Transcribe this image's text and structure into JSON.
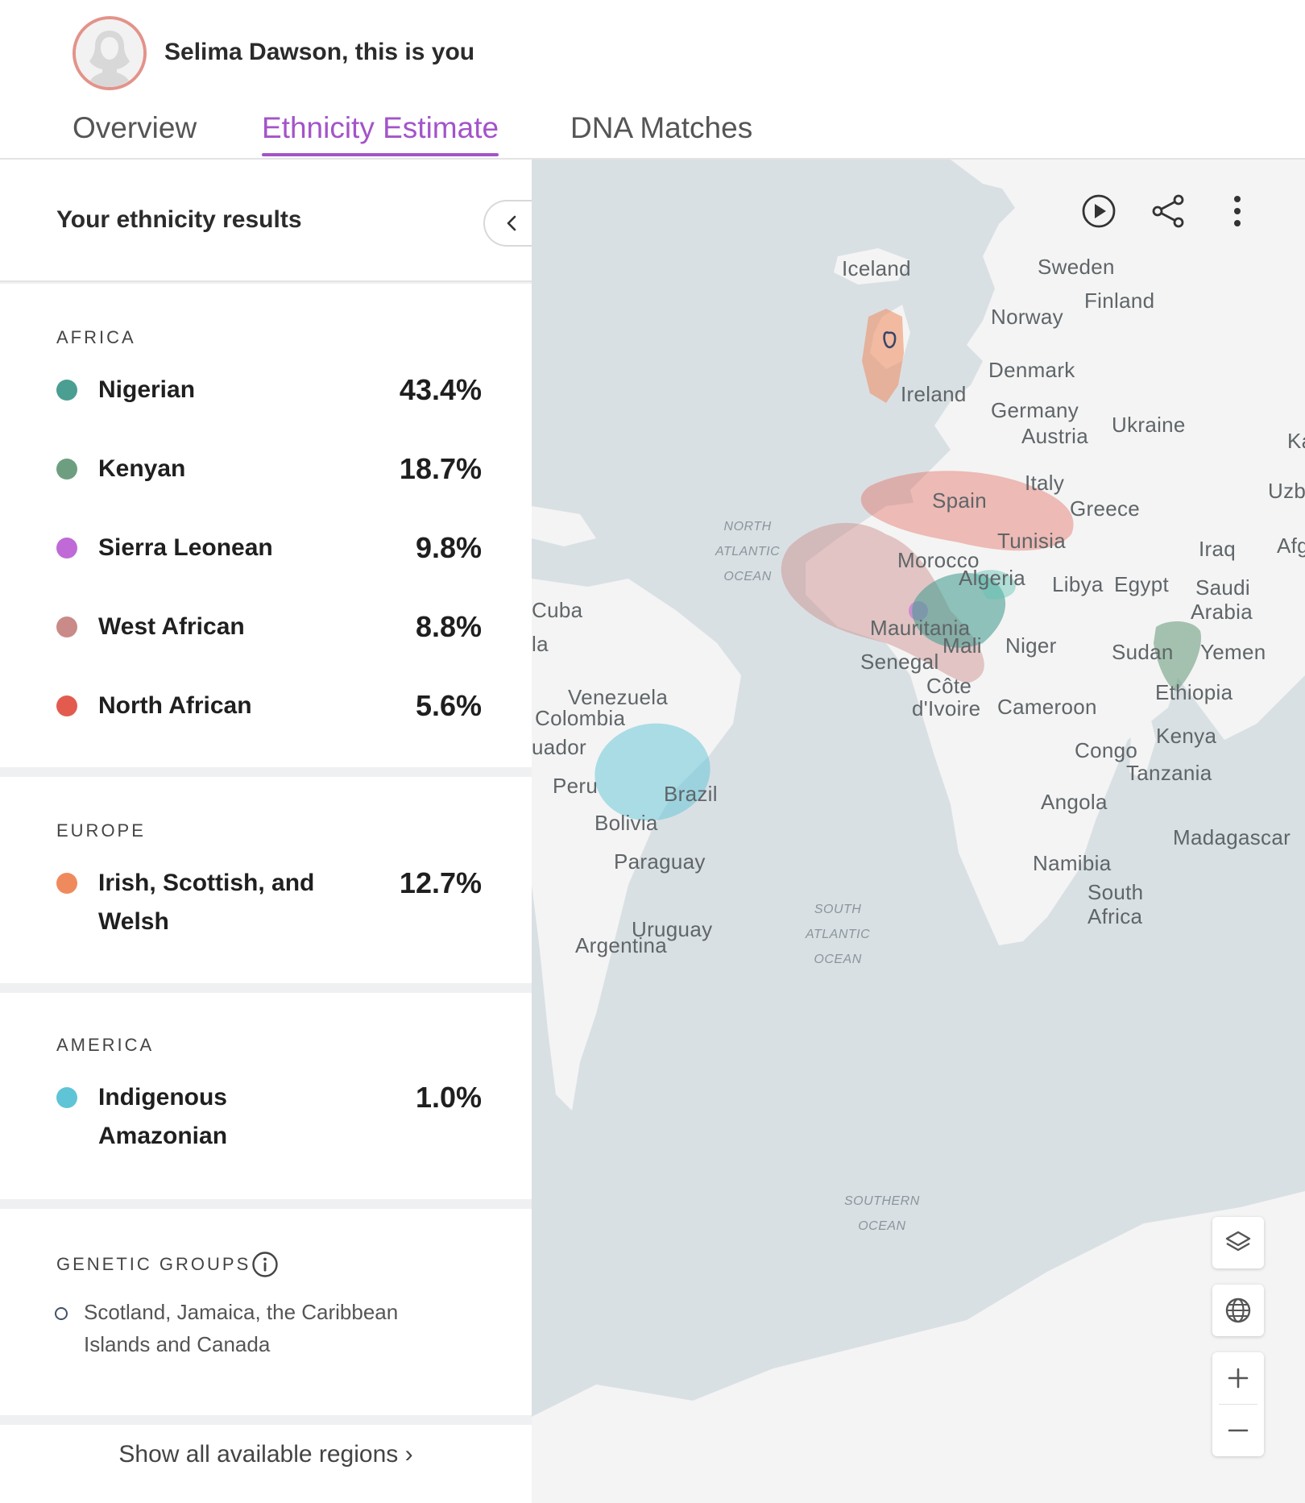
{
  "header": {
    "user_name": "Selima Dawson, this is you",
    "tabs": [
      {
        "label": "Overview",
        "active": false
      },
      {
        "label": "Ethnicity Estimate",
        "active": true
      },
      {
        "label": "DNA Matches",
        "active": false
      }
    ]
  },
  "panel": {
    "title": "Your ethnicity results",
    "sections": [
      {
        "label": "AFRICA",
        "regions": [
          {
            "name": "Nigerian",
            "percent": "43.4%",
            "color": "#4a9e92"
          },
          {
            "name": "Kenyan",
            "percent": "18.7%",
            "color": "#6e9e80"
          },
          {
            "name": "Sierra Leonean",
            "percent": "9.8%",
            "color": "#c06ad8"
          },
          {
            "name": "West African",
            "percent": "8.8%",
            "color": "#c98a88"
          },
          {
            "name": "North African",
            "percent": "5.6%",
            "color": "#e35b4f"
          }
        ]
      },
      {
        "label": "EUROPE",
        "regions": [
          {
            "name": "Irish, Scottish, and Welsh",
            "percent": "12.7%",
            "color": "#ef8a5d"
          }
        ]
      },
      {
        "label": "AMERICA",
        "regions": [
          {
            "name": "Indigenous Amazonian",
            "percent": "1.0%",
            "color": "#5fc4d6"
          }
        ]
      }
    ],
    "genetic_groups": {
      "label": "GENETIC GROUPS",
      "items": [
        "Scotland, Jamaica, the Caribbean Islands and Canada"
      ]
    },
    "show_all": "Show all available regions ›"
  },
  "map": {
    "countries": [
      "Iceland",
      "Sweden",
      "Finland",
      "Norway",
      "Denmark",
      "Ireland",
      "Germany",
      "Austria",
      "Ukraine",
      "Ka",
      "Italy",
      "Uzb",
      "Spain",
      "Greece",
      "Tunisia",
      "Iraq",
      "Afg",
      "Morocco",
      "Algeria",
      "Libya",
      "Egypt",
      "Saudi",
      "Arabia",
      "Cuba",
      "la",
      "Mauritania",
      "Mali",
      "Niger",
      "Sudan",
      "Yemen",
      "Senegal",
      "Côte",
      "d'Ivoire",
      "Cameroon",
      "Ethiopia",
      "Venezuela",
      "Colombia",
      "uador",
      "Kenya",
      "Congo",
      "Tanzania",
      "Peru",
      "Brazil",
      "Angola",
      "Bolivia",
      "Madagascar",
      "Paraguay",
      "Namibia",
      "South",
      "Africa",
      "Uruguay",
      "Argentina"
    ],
    "oceans": [
      {
        "lines": [
          "NORTH",
          "ATLANTIC",
          "OCEAN"
        ]
      },
      {
        "lines": [
          "SOUTH",
          "ATLANTIC",
          "OCEAN"
        ]
      },
      {
        "lines": [
          "SOUTHERN",
          "OCEAN"
        ]
      }
    ],
    "controls": [
      "play-icon",
      "share-icon",
      "more-icon",
      "layers-icon",
      "globe-icon",
      "zoom-in-icon",
      "zoom-out-icon"
    ]
  }
}
